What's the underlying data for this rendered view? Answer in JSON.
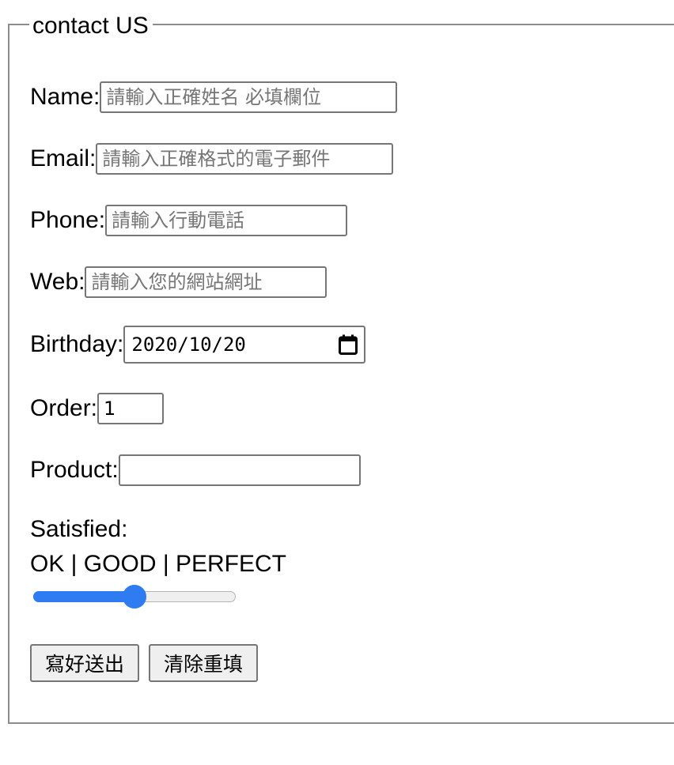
{
  "form": {
    "legend": "contact US",
    "fields": {
      "name": {
        "label": "Name:",
        "placeholder": "請輸入正確姓名 必填欄位"
      },
      "email": {
        "label": "Email:",
        "placeholder": "請輸入正確格式的電子郵件"
      },
      "phone": {
        "label": "Phone:",
        "placeholder": "請輸入行動電話"
      },
      "web": {
        "label": "Web:",
        "placeholder": "請輸入您的網站網址"
      },
      "birthday": {
        "label": "Birthday:",
        "value": "2020/10/20",
        "icon": "calendar-icon"
      },
      "order": {
        "label": "Order:",
        "value": "1"
      },
      "product": {
        "label": "Product:",
        "value": ""
      }
    },
    "satisfied": {
      "label": "Satisfied:",
      "scale_text": "OK | GOOD | PERFECT",
      "value": 0.5,
      "accent": "#2f7bf2"
    },
    "buttons": {
      "submit": "寫好送出",
      "reset": "清除重填"
    }
  }
}
